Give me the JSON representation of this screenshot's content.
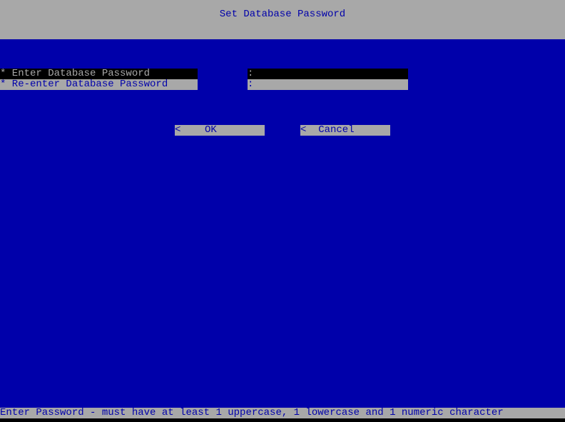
{
  "header": {
    "title": "Set Database Password"
  },
  "form": {
    "field1": {
      "label": "* Enter Database Password",
      "colon": ":"
    },
    "field2": {
      "label": "* Re-enter Database Password",
      "colon": ":"
    }
  },
  "buttons": {
    "ok": "<    OK        >",
    "cancel": "<  Cancel      >"
  },
  "footer": {
    "hint": "Enter Password - must have at least 1 uppercase, 1 lowercase and 1 numeric character"
  }
}
